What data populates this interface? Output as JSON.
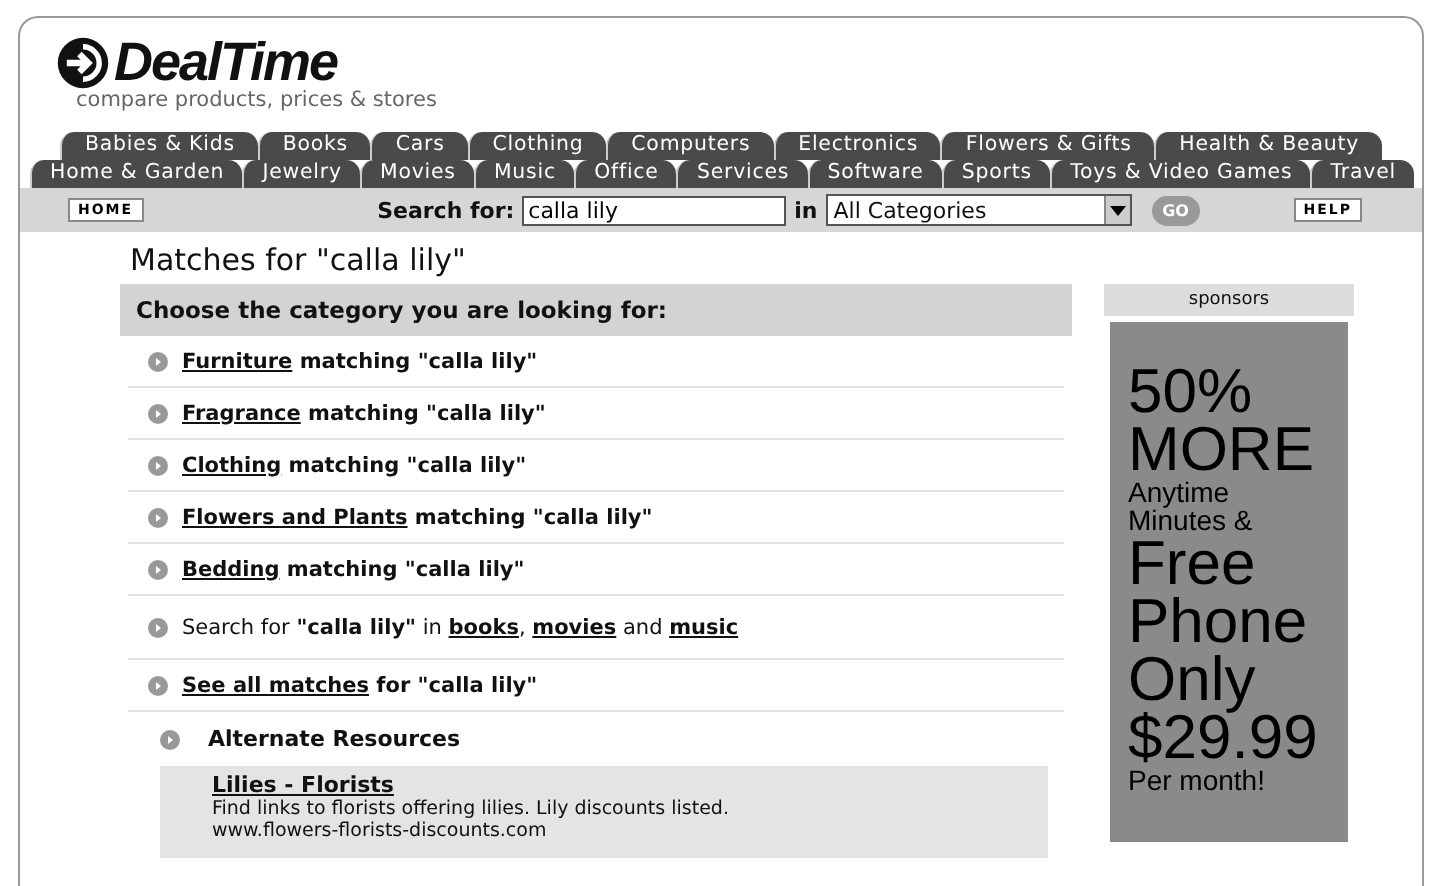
{
  "logo": {
    "name": "DealTime",
    "tagline": "compare products, prices & stores"
  },
  "tab_rows": [
    [
      "Babies & Kids",
      "Books",
      "Cars",
      "Clothing",
      "Computers",
      "Electronics",
      "Flowers & Gifts",
      "Health & Beauty"
    ],
    [
      "Home & Garden",
      "Jewelry",
      "Movies",
      "Music",
      "Office",
      "Services",
      "Software",
      "Sports",
      "Toys & Video Games",
      "Travel"
    ]
  ],
  "toolbar": {
    "home_button": "HOME",
    "search_label": "Search for:",
    "search_value": "calla lily",
    "in_label": "in",
    "category": "All Categories",
    "go_button": "GO",
    "help_button": "HELP"
  },
  "title": "Matches for \"calla lily\"",
  "panel_heading": "Choose the category you are looking for:",
  "items": [
    {
      "kind": "category",
      "parts": [
        {
          "text": "Furniture",
          "link": true
        },
        {
          "text": " matching \"calla lily\"",
          "link": false
        }
      ]
    },
    {
      "kind": "category",
      "parts": [
        {
          "text": "Fragrance",
          "link": true
        },
        {
          "text": " matching \"calla lily\"",
          "link": false
        }
      ]
    },
    {
      "kind": "category",
      "parts": [
        {
          "text": "Clothing",
          "link": true
        },
        {
          "text": " matching \"calla lily\"",
          "link": false
        }
      ]
    },
    {
      "kind": "category",
      "parts": [
        {
          "text": "Flowers and Plants",
          "link": true
        },
        {
          "text": " matching \"calla lily\"",
          "link": false
        }
      ]
    },
    {
      "kind": "category",
      "parts": [
        {
          "text": "Bedding",
          "link": true
        },
        {
          "text": " matching \"calla lily\"",
          "link": false
        }
      ]
    },
    {
      "kind": "search",
      "parts": [
        {
          "text": "Search for **\"calla lily\"** in ",
          "link": false
        },
        {
          "text": "books",
          "link": true
        },
        {
          "text": ", ",
          "link": false
        },
        {
          "text": "movies",
          "link": true
        },
        {
          "text": " and ",
          "link": false
        },
        {
          "text": "music",
          "link": true
        }
      ]
    },
    {
      "kind": "category",
      "parts": [
        {
          "text": "See all matches",
          "link": true
        },
        {
          "text": " for \"calla lily\"",
          "link": false
        }
      ]
    }
  ],
  "alternate": {
    "heading": "Alternate Resources",
    "results": [
      {
        "title": "Lilies - Florists",
        "description": "Find links to florists offering lilies. Lily discounts listed.",
        "url": "www.flowers-florists-discounts.com"
      }
    ]
  },
  "sponsors": {
    "heading": "sponsors",
    "ad_lines": [
      {
        "text": "50%",
        "kind": "big"
      },
      {
        "text": "MORE",
        "kind": "big"
      },
      {
        "text": "Anytime",
        "kind": "small"
      },
      {
        "text": "Minutes &",
        "kind": "small"
      },
      {
        "text": "Free",
        "kind": "big"
      },
      {
        "text": "Phone",
        "kind": "big"
      },
      {
        "text": "Only",
        "kind": "big"
      },
      {
        "text": "$29.99",
        "kind": "big"
      },
      {
        "text": "Per month!",
        "kind": "small"
      }
    ]
  }
}
